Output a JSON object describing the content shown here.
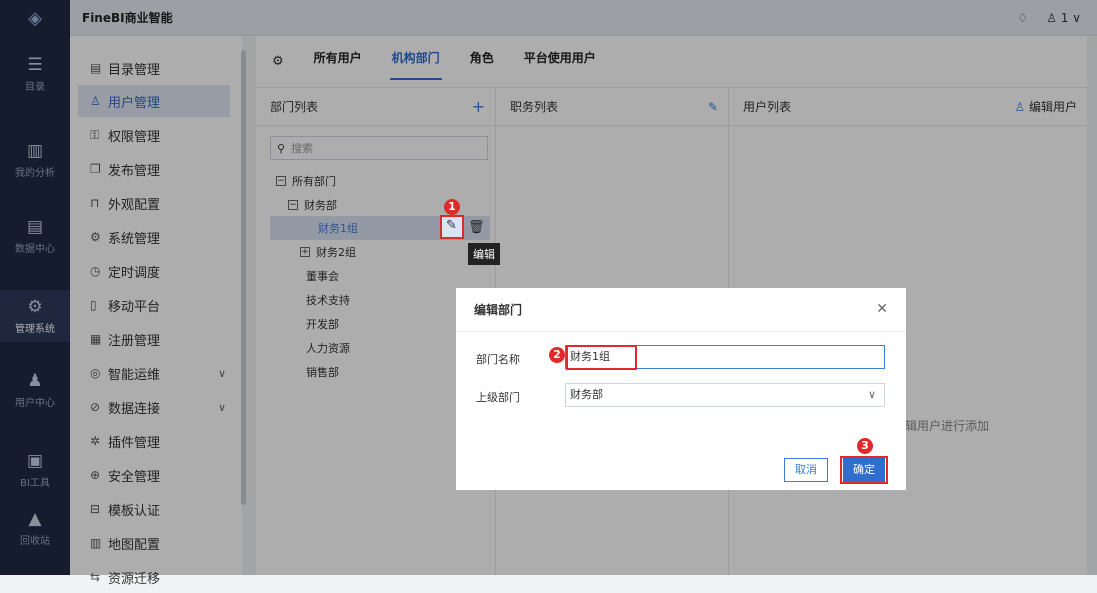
{
  "app": {
    "title": "FineBI商业智能"
  },
  "topbar": {
    "bell_icon": "bell-icon",
    "user_icon": "user-icon",
    "user_label": "1 ∨"
  },
  "rail": [
    {
      "label": "目录",
      "icon": "catalog-icon"
    },
    {
      "label": "我的分析",
      "icon": "analysis-icon"
    },
    {
      "label": "数据中心",
      "icon": "data-center-icon"
    },
    {
      "label": "管理系统",
      "icon": "gear-icon"
    },
    {
      "label": "用户中心",
      "icon": "users-icon"
    },
    {
      "label": "BI工具",
      "icon": "toolbox-icon"
    },
    {
      "label": "回收站",
      "icon": "recycle-icon"
    }
  ],
  "menu": [
    {
      "label": "目录管理",
      "icon": "▤"
    },
    {
      "label": "用户管理",
      "icon": "♙"
    },
    {
      "label": "权限管理",
      "icon": "⚿"
    },
    {
      "label": "发布管理",
      "icon": "❐"
    },
    {
      "label": "外观配置",
      "icon": "⊓"
    },
    {
      "label": "系统管理",
      "icon": "⚙"
    },
    {
      "label": "定时调度",
      "icon": "◷"
    },
    {
      "label": "移动平台",
      "icon": "▯"
    },
    {
      "label": "注册管理",
      "icon": "▦"
    },
    {
      "label": "智能运维",
      "icon": "◎"
    },
    {
      "label": "数据连接",
      "icon": "⊘"
    },
    {
      "label": "插件管理",
      "icon": "✲"
    },
    {
      "label": "安全管理",
      "icon": "⊕"
    },
    {
      "label": "模板认证",
      "icon": "⊟"
    },
    {
      "label": "地图配置",
      "icon": "▥"
    },
    {
      "label": "资源迁移",
      "icon": "⇆"
    }
  ],
  "tabs": [
    "所有用户",
    "机构部门",
    "角色",
    "平台使用用户"
  ],
  "panels": {
    "dept": {
      "title": "部门列表",
      "action": "+",
      "search_placeholder": "搜索"
    },
    "position": {
      "title": "职务列表"
    },
    "users": {
      "title": "用户列表",
      "action": "编辑用户",
      "empty_hint": "辑用户进行添加"
    }
  },
  "tree": [
    {
      "label": "所有部门",
      "box": "−"
    },
    {
      "label": "财务部",
      "box": "−"
    },
    {
      "label": "财务1组"
    },
    {
      "label": "财务2组",
      "box": "+"
    },
    {
      "label": "董事会"
    },
    {
      "label": "技术支持"
    },
    {
      "label": "开发部"
    },
    {
      "label": "人力资源"
    },
    {
      "label": "销售部"
    }
  ],
  "tooltip": "编辑",
  "modal": {
    "title": "编辑部门",
    "name_label": "部门名称",
    "name_value": "财务1组",
    "parent_label": "上级部门",
    "parent_value": "财务部",
    "cancel": "取消",
    "ok": "确定"
  },
  "badges": [
    "1",
    "2",
    "3"
  ],
  "colors": {
    "accent": "#2f6ecf",
    "highlight": "#e02a2a",
    "rail": "#1f2a44"
  }
}
